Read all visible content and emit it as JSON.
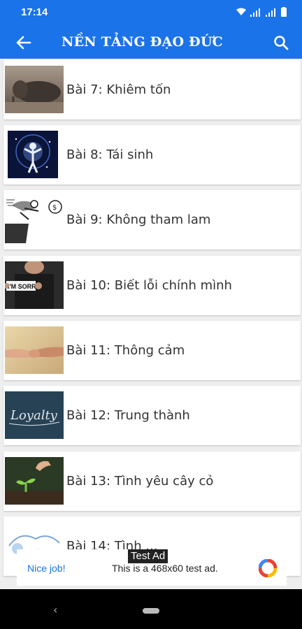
{
  "status": {
    "time": "17:14"
  },
  "appbar": {
    "title": "NỀN TẢNG ĐẠO ĐỨC"
  },
  "lessons": [
    {
      "label": "Bài 7: Khiêm tốn",
      "image": "elephant-photo"
    },
    {
      "label": "Bài 8: Tái sinh",
      "image": "glowing-figure-photo"
    },
    {
      "label": "Bài 9: Không tham lam",
      "image": "cartoon-money-chase"
    },
    {
      "label": "Bài 10: Biết lỗi chính mình",
      "image": "im-sorry-sign-photo"
    },
    {
      "label": "Bài 11: Thông cảm",
      "image": "handshake-photo"
    },
    {
      "label": "Bài 12: Trung thành",
      "image": "loyalty-chalkboard"
    },
    {
      "label": "Bài 13: Tình yêu cây cỏ",
      "image": "seedling-photo"
    },
    {
      "label": "Bài 14: Tình ...",
      "image": "cartoon-sketch"
    }
  ],
  "ad": {
    "badge": "Test Ad",
    "headline": "Nice job!",
    "description": "This is a 468x60 test ad."
  },
  "colors": {
    "primary": "#1a73e8",
    "background": "#eeeeee"
  }
}
